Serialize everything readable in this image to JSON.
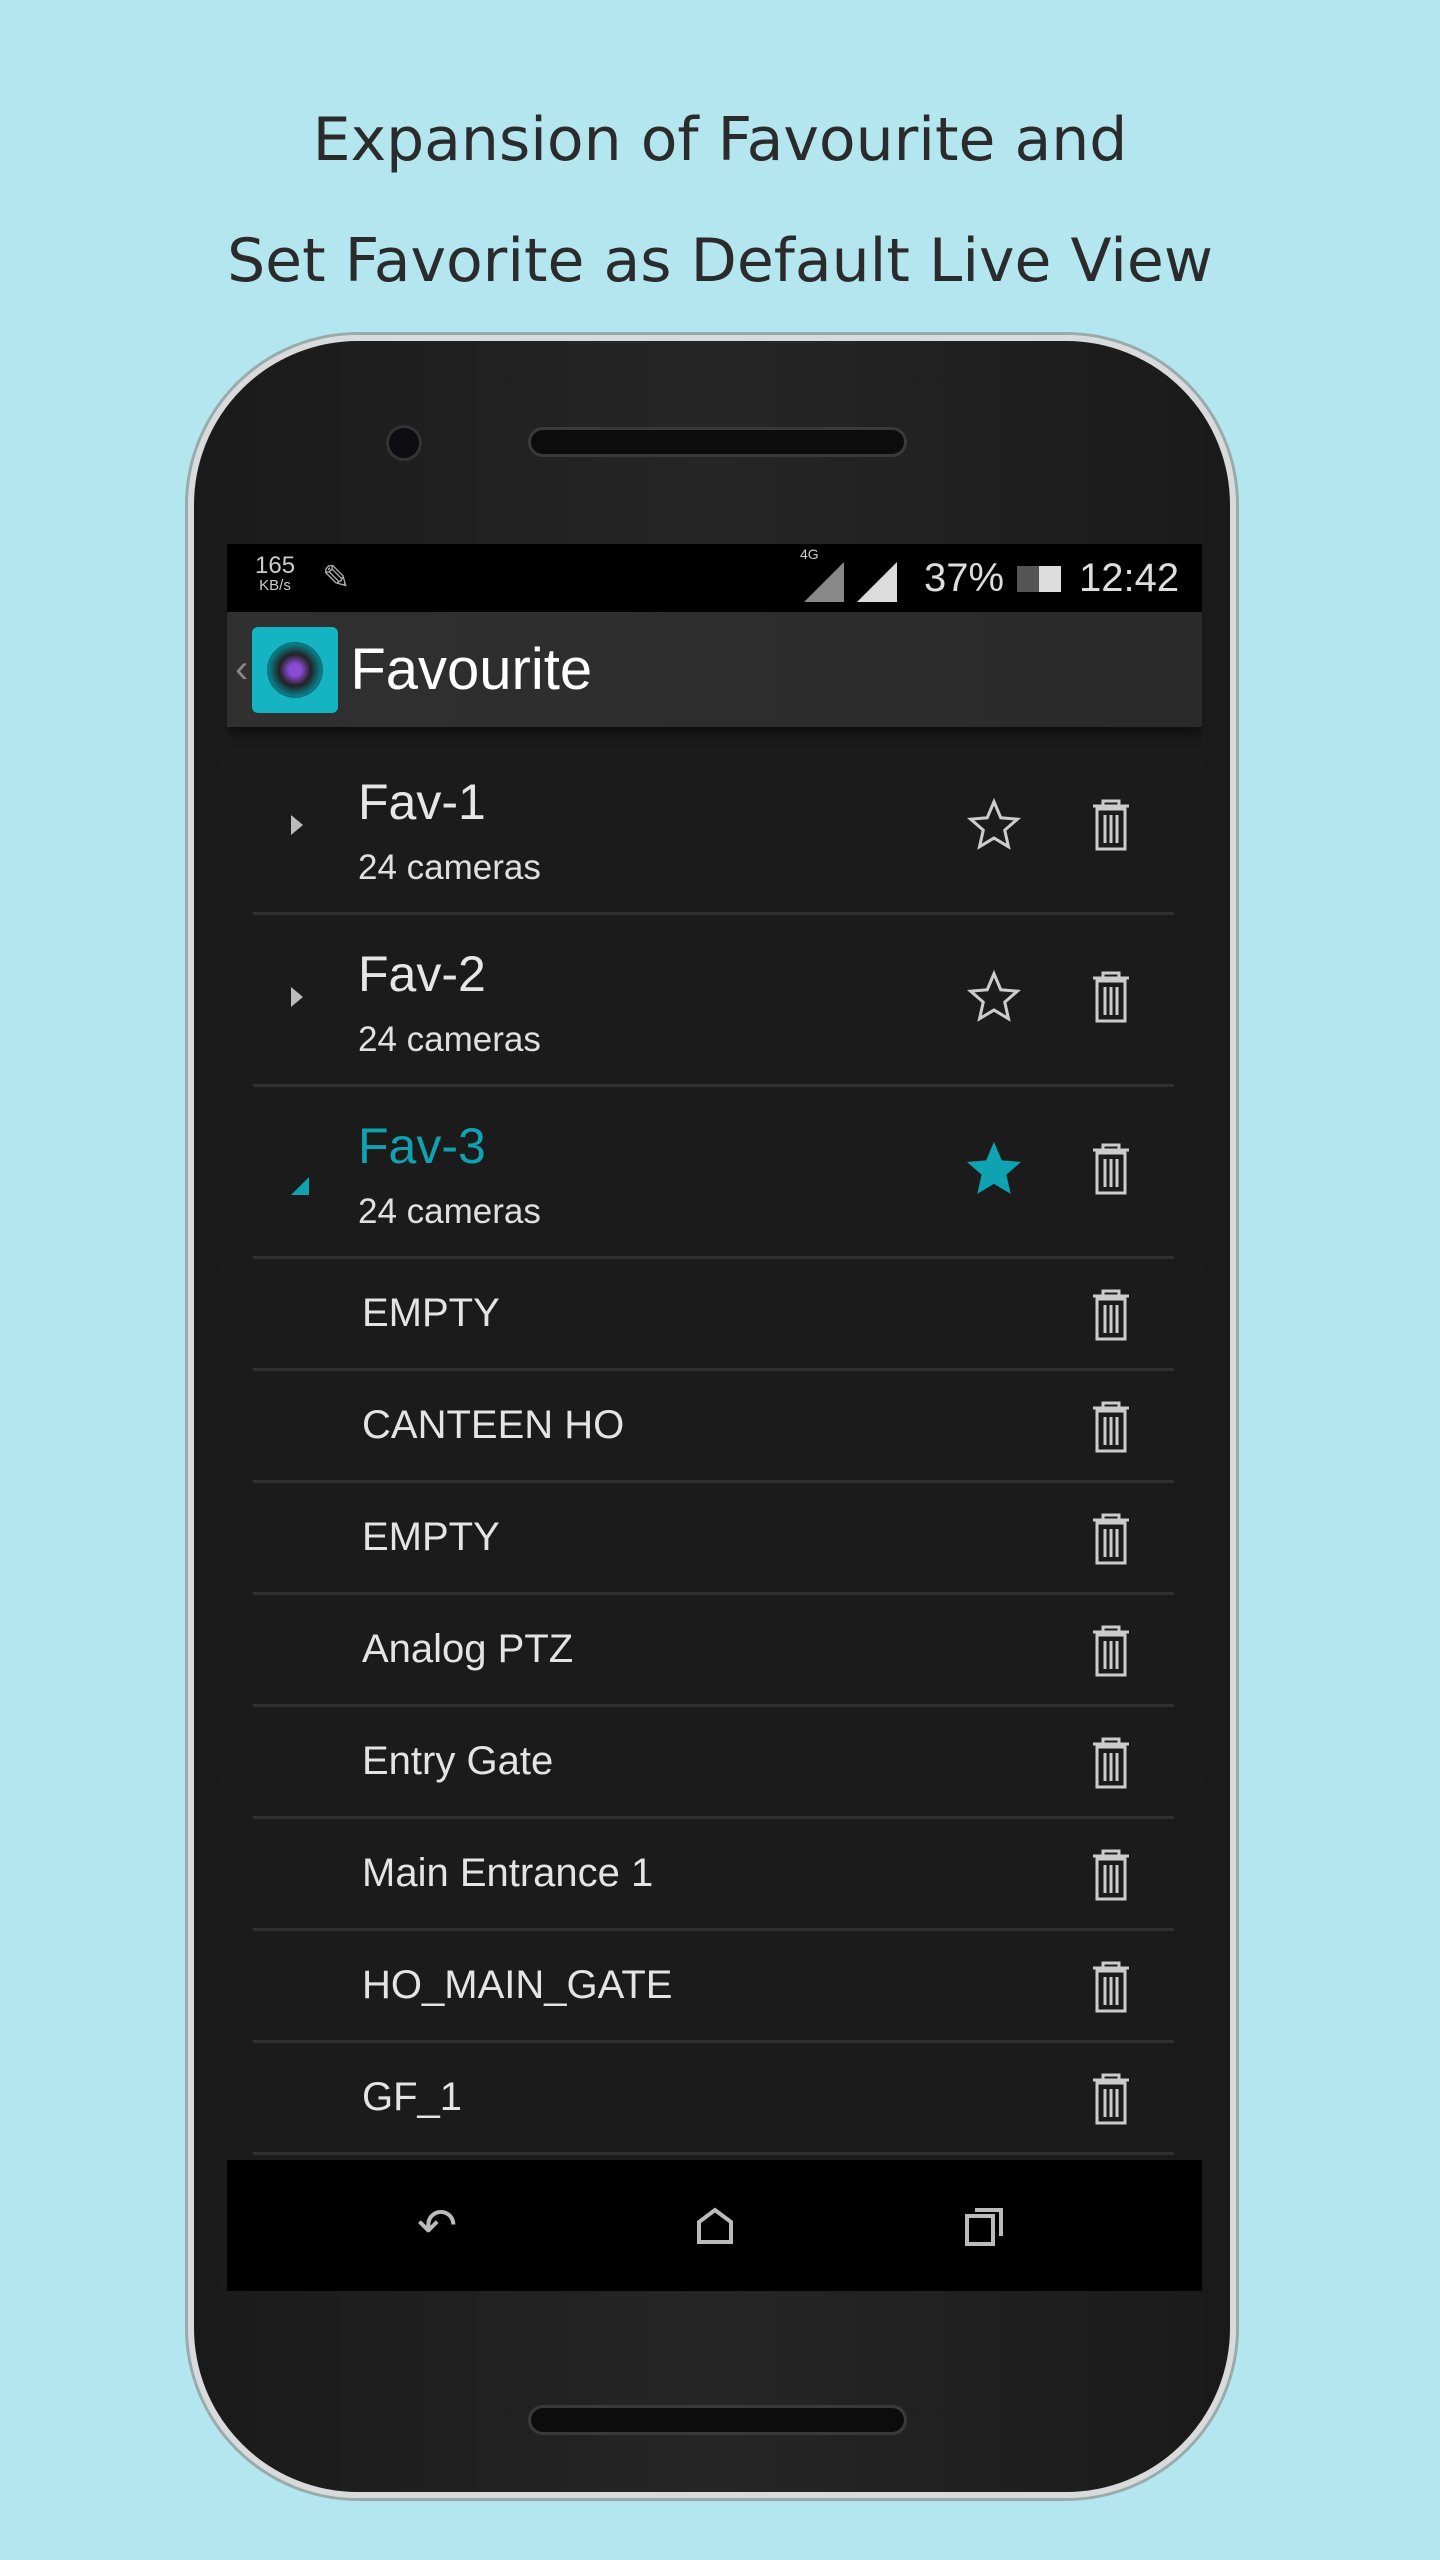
{
  "caption": {
    "line1": "Expansion of Favourite and",
    "line2": "Set Favorite as Default Live View"
  },
  "status_bar": {
    "speed": "165",
    "speed_unit": "KB/s",
    "network": "4G",
    "battery": "37%",
    "time": "12:42"
  },
  "app_bar": {
    "title": "Favourite"
  },
  "accent": "#0fa3b1",
  "groups": [
    {
      "name": "Fav-1",
      "count": "24 cameras",
      "expanded": false,
      "default": false
    },
    {
      "name": "Fav-2",
      "count": "24 cameras",
      "expanded": false,
      "default": false
    },
    {
      "name": "Fav-3",
      "count": "24 cameras",
      "expanded": true,
      "default": true
    }
  ],
  "cameras": [
    "EMPTY",
    "CANTEEN HO",
    "EMPTY",
    "Analog PTZ",
    "Entry Gate",
    "Main Entrance 1",
    "HO_MAIN_GATE",
    "GF_1"
  ]
}
